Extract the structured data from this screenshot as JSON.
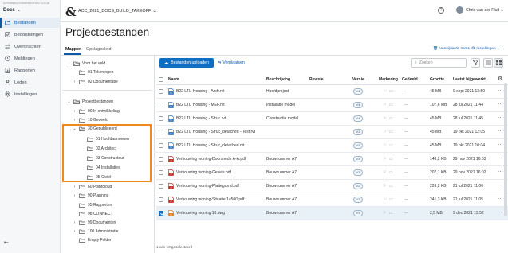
{
  "app": {
    "brand": "AUTODESK CONSTRUCTION CLOUD",
    "module": "Docs"
  },
  "nav": [
    {
      "label": "Bestanden",
      "icon": "folder-icon",
      "active": true
    },
    {
      "label": "Beoordelingen",
      "icon": "review-icon"
    },
    {
      "label": "Overdrachten",
      "icon": "transfer-icon"
    },
    {
      "label": "Meldingen",
      "icon": "issue-icon"
    },
    {
      "label": "Rapporten",
      "icon": "report-icon"
    },
    {
      "label": "Leden",
      "icon": "members-icon"
    },
    {
      "label": "Instellingen",
      "icon": "gear-icon"
    }
  ],
  "topbar": {
    "project": "ACC_2021_DOCS_BUILD_TAKEOFF",
    "help": "?",
    "user": "Chris van der Fluit"
  },
  "page": {
    "title": "Projectbestanden",
    "tabs": [
      "Mappen",
      "Opslagbeleid"
    ],
    "deleted_link": "Verwijderde items",
    "settings_link": "Instellingen"
  },
  "tree": [
    {
      "label": "Voor het veld",
      "indent": 0,
      "arrow": "v",
      "icon": "folder-open"
    },
    {
      "label": "01 Tekeningen",
      "indent": 1,
      "arrow": "",
      "icon": "folder"
    },
    {
      "label": "02 Documentatie",
      "indent": 1,
      "arrow": ">",
      "icon": "folder"
    },
    {
      "label": "Projectbestanden",
      "indent": 0,
      "arrow": "v",
      "icon": "folder-open"
    },
    {
      "label": "00 In ontwikkeling",
      "indent": 1,
      "arrow": ">",
      "icon": "folder"
    },
    {
      "label": "10 Gedeeld",
      "indent": 1,
      "arrow": ">",
      "icon": "folder"
    },
    {
      "label": "30 Gepubliceerd",
      "indent": 1,
      "arrow": "v",
      "icon": "folder-open"
    },
    {
      "label": "01 Hoofdaannemer",
      "indent": 2,
      "arrow": "",
      "icon": "folder"
    },
    {
      "label": "02 Architect",
      "indent": 2,
      "arrow": "",
      "icon": "folder"
    },
    {
      "label": "03 Constructeur",
      "indent": 2,
      "arrow": "",
      "icon": "folder"
    },
    {
      "label": "04 Installaties",
      "indent": 2,
      "arrow": "",
      "icon": "folder"
    },
    {
      "label": "05 Civiel",
      "indent": 2,
      "arrow": "",
      "icon": "folder"
    },
    {
      "label": "60 Pointcloud",
      "indent": 1,
      "arrow": ">",
      "icon": "folder"
    },
    {
      "label": "90 Planning",
      "indent": 1,
      "arrow": ">",
      "icon": "folder"
    },
    {
      "label": "95 Rapporten",
      "indent": 1,
      "arrow": "",
      "icon": "folder"
    },
    {
      "label": "98 CONNECT",
      "indent": 1,
      "arrow": "",
      "icon": "folder"
    },
    {
      "label": "99 Documenten",
      "indent": 1,
      "arrow": ">",
      "icon": "folder"
    },
    {
      "label": "100 Administratie",
      "indent": 1,
      "arrow": ">",
      "icon": "folder"
    },
    {
      "label": "Empty Folder",
      "indent": 1,
      "arrow": "",
      "icon": "folder"
    }
  ],
  "toolbar": {
    "upload": "Bestanden uploaden",
    "move": "Verplaatsen",
    "search_placeholder": "Zoeken"
  },
  "columns": [
    "Naam",
    "Beschrijving",
    "Revisie",
    "Versie",
    "Markering",
    "Gedeeld",
    "Grootte",
    "Laatst bijgewerkt"
  ],
  "files": [
    {
      "name": "B22 LTU Housing - Arch.rvt",
      "desc": "Hoofdproject",
      "ver": "V4",
      "shared": "—",
      "size": "45 MB",
      "date": "9 sept 2021 13:50",
      "type": "rvt"
    },
    {
      "name": "B22 LTU Housing - MEP.rvt",
      "desc": "Installatie model",
      "ver": "V4",
      "shared": "—",
      "size": "107,6 MB",
      "date": "28 jul 2021 11:44",
      "type": "rvt"
    },
    {
      "name": "B22 LTU Housing - Struc.rvt",
      "desc": "Constructie model",
      "ver": "V4",
      "shared": "—",
      "size": "45 MB",
      "date": "28 jul 2021 11:45",
      "type": "rvt"
    },
    {
      "name": "B22 LTU Housing - Struc_detached - Test.rvt",
      "desc": "",
      "ver": "V2",
      "shared": "—",
      "size": "45 MB",
      "date": "19 okt 2021 12:05",
      "type": "rvt"
    },
    {
      "name": "B22 LTU Housing - Struc_detached.rvt",
      "desc": "",
      "ver": "V3",
      "shared": "—",
      "size": "45 MB",
      "date": "19 okt 2021 10:04",
      "type": "rvt"
    },
    {
      "name": "Verbouwing woning-Doorsnede A-A.pdf",
      "desc": "Bouwnummer A7",
      "ver": "V3",
      "shared": "—",
      "size": "148,2 KB",
      "date": "29 nov 2021 16:03",
      "type": "pdf"
    },
    {
      "name": "Verbouwing woning-Gevels.pdf",
      "desc": "Bouwnummer A7",
      "ver": "V3",
      "shared": "—",
      "size": "207,1 KB",
      "date": "29 nov 2021 16:02",
      "type": "pdf"
    },
    {
      "name": "Verbouwing woning-Plattegrond.pdf",
      "desc": "Bouwnummer A7",
      "ver": "V2",
      "shared": "—",
      "size": "226,2 KB",
      "date": "21 jul 2021 11:06",
      "type": "pdf"
    },
    {
      "name": "Verbouwing woning-Situatie 1a500.pdf",
      "desc": "Bouwnummer A7",
      "ver": "V3",
      "shared": "—",
      "size": "241,3 KB",
      "date": "21 jul 2021 11:05",
      "type": "pdf"
    },
    {
      "name": "Verbouwing woning 10.dwg",
      "desc": "Bouwnummer A7",
      "ver": "V3",
      "shared": "—",
      "size": "2,5 MB",
      "date": "9 dec 2021 13:52",
      "type": "dwg",
      "selected": true
    }
  ],
  "footer": "1 van 10 geselecteerd",
  "colors": {
    "accent": "#0f6ec1",
    "highlight": "#f08a1c",
    "pdf": "#c9302c",
    "rvt": "#3f7fc0",
    "dwg": "#e07b1c"
  }
}
